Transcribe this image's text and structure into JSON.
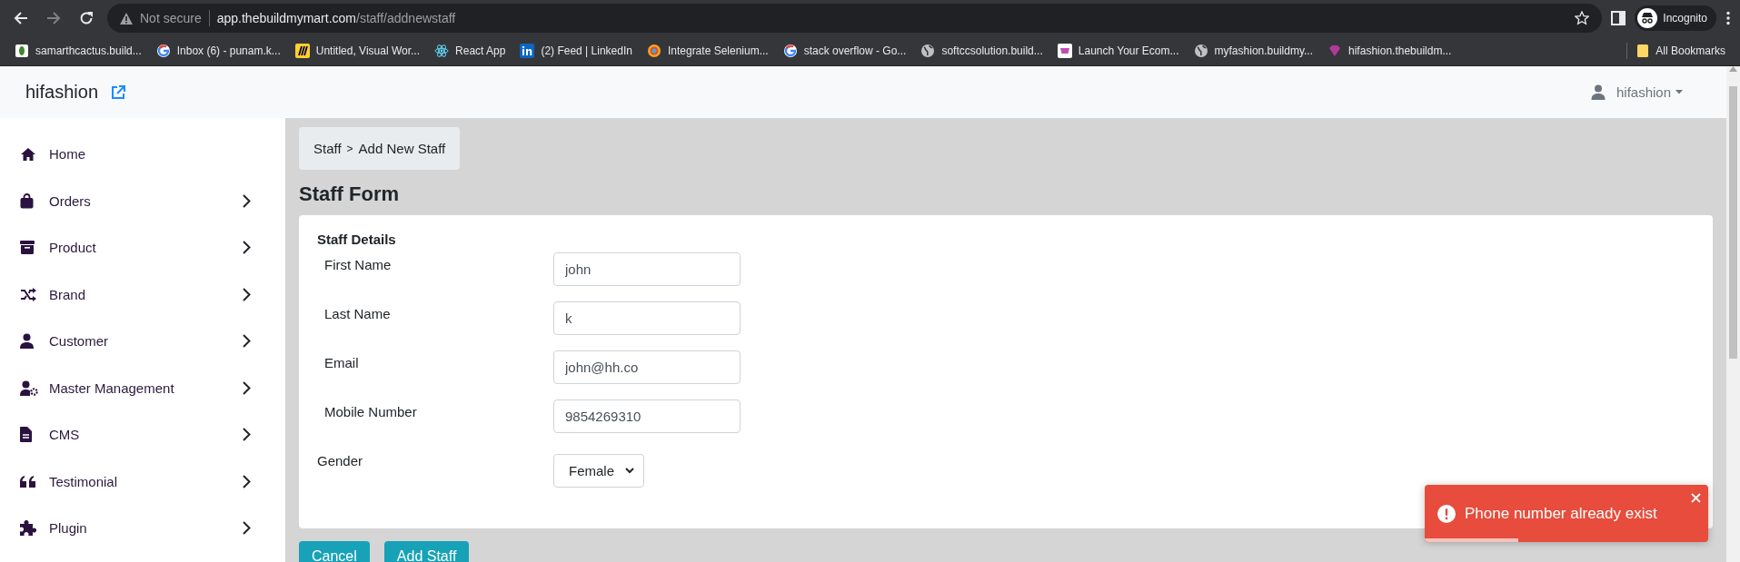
{
  "browser": {
    "url": {
      "security": "Not secure",
      "host": "app.thebuildmymart.com",
      "path": "/staff/addnewstaff"
    },
    "profile": "Incognito",
    "bookmarks": [
      {
        "label": "samarthcactus.build...",
        "kind": "cactus"
      },
      {
        "label": "Inbox (6) - punam.k...",
        "kind": "google"
      },
      {
        "label": "Untitled, Visual Wor...",
        "kind": "miro"
      },
      {
        "label": "React App",
        "kind": "react"
      },
      {
        "label": "(2) Feed | LinkedIn",
        "kind": "linkedin"
      },
      {
        "label": "Integrate Selenium...",
        "kind": "ring"
      },
      {
        "label": "stack overflow - Go...",
        "kind": "google"
      },
      {
        "label": "softccsolution.build...",
        "kind": "globe"
      },
      {
        "label": "Launch Your Ecom...",
        "kind": "store"
      },
      {
        "label": "myfashion.buildmy...",
        "kind": "globe"
      },
      {
        "label": "hifashion.thebuildm...",
        "kind": "gem"
      }
    ],
    "all_bookmarks": "All Bookmarks"
  },
  "header": {
    "brand": "hifashion",
    "user": "hifashion"
  },
  "sidebar": {
    "items": [
      {
        "label": "Home",
        "expandable": false
      },
      {
        "label": "Orders",
        "expandable": true
      },
      {
        "label": "Product",
        "expandable": true
      },
      {
        "label": "Brand",
        "expandable": true
      },
      {
        "label": "Customer",
        "expandable": true
      },
      {
        "label": "Master Management",
        "expandable": true
      },
      {
        "label": "CMS",
        "expandable": true
      },
      {
        "label": "Testimonial",
        "expandable": true
      },
      {
        "label": "Plugin",
        "expandable": true
      }
    ]
  },
  "breadcrumb": {
    "items": [
      "Staff",
      "Add New Staff"
    ],
    "separator": ">"
  },
  "form": {
    "title": "Staff Form",
    "section": "Staff Details",
    "fields": [
      {
        "label": "First Name",
        "kind": "text",
        "value": "john"
      },
      {
        "label": "Last Name",
        "kind": "text",
        "value": "k"
      },
      {
        "label": "Email",
        "kind": "text",
        "value": "john@hh.co"
      },
      {
        "label": "Mobile Number",
        "kind": "text",
        "value": "9854269310"
      },
      {
        "label": "Gender",
        "kind": "select",
        "value": "Female"
      }
    ],
    "buttons": [
      "Cancel",
      "Add Staff"
    ]
  },
  "toast": {
    "message": "Phone number already exist",
    "level": 0.33
  }
}
